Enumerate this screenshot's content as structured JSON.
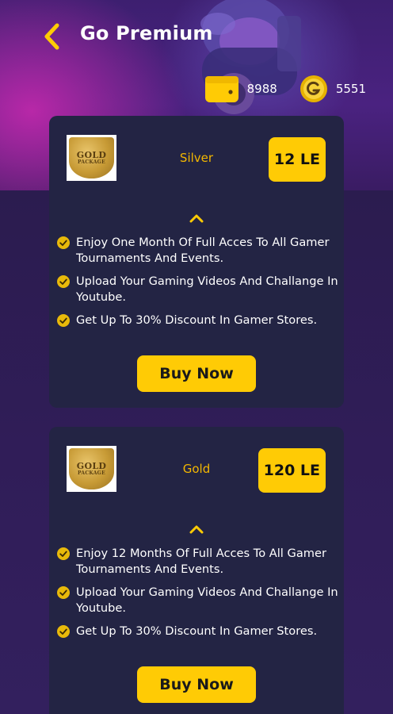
{
  "header": {
    "title": "Go Premium",
    "back_icon": "chevron-left-icon"
  },
  "balances": {
    "wallet_value": "8988",
    "coins_value": "5551",
    "wallet_icon": "wallet-icon",
    "coin_icon": "g-coin-icon"
  },
  "colors": {
    "accent": "#ffcb05",
    "tier_text": "#f3b700",
    "card_bg": "#232444",
    "page_bg": "#2b1c4f"
  },
  "badge": {
    "line1": "GOLD",
    "line2": "PACKAGE"
  },
  "plans": [
    {
      "name": "Silver",
      "price": "12 LE",
      "features": [
        "Enjoy One Month Of Full Acces To All Gamer Tournaments And Events.",
        "Upload Your Gaming Videos And Challange In Youtube.",
        "Get Up To 30% Discount In Gamer Stores."
      ],
      "button_label": "Buy Now"
    },
    {
      "name": "Gold",
      "price": "120 LE",
      "features": [
        "Enjoy 12 Months Of Full Acces To All Gamer Tournaments And Events.",
        "Upload Your Gaming Videos And Challange In Youtube.",
        "Get Up To 30% Discount In Gamer Stores."
      ],
      "button_label": "Buy Now"
    }
  ]
}
